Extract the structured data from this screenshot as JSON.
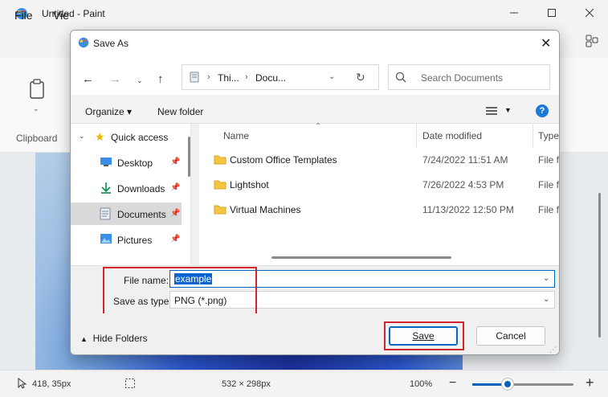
{
  "paint": {
    "title": "Untitled - Paint",
    "menu_file": "File",
    "menu_view": "Vie",
    "clipboard_label": "Clipboard",
    "status": {
      "coords": "418, 35px",
      "size": "532 × 298px",
      "zoom": "100%",
      "zoom_fraction": 0.35
    }
  },
  "dialog": {
    "title": "Save As",
    "address": {
      "seg1": "Thi...",
      "seg2": "Docu..."
    },
    "search_placeholder": "Search Documents",
    "organize_label": "Organize ▾",
    "new_folder_label": "New folder",
    "help_label": "?",
    "nav": {
      "quick_access": "Quick access",
      "items": [
        {
          "label": "Desktop",
          "icon": "desktop-icon"
        },
        {
          "label": "Downloads",
          "icon": "download-icon"
        },
        {
          "label": "Documents",
          "icon": "documents-icon",
          "selected": true
        },
        {
          "label": "Pictures",
          "icon": "pictures-icon"
        }
      ]
    },
    "columns": {
      "name": "Name",
      "date": "Date modified",
      "type": "Type"
    },
    "files": [
      {
        "name": "Custom Office Templates",
        "date": "7/24/2022 11:51 AM",
        "type": "File fo"
      },
      {
        "name": "Lightshot",
        "date": "7/26/2022 4:53 PM",
        "type": "File fo"
      },
      {
        "name": "Virtual Machines",
        "date": "11/13/2022 12:50 PM",
        "type": "File fo"
      }
    ],
    "file_name_label": "File name:",
    "file_name_value": "example",
    "save_type_label": "Save as type:",
    "save_type_value": "PNG (*.png)",
    "hide_folders_label": "Hide Folders",
    "save_label": "Save",
    "cancel_label": "Cancel"
  },
  "colors": {
    "accent": "#0067c0",
    "highlight_box": "#d1242f",
    "folder": "#f5c542"
  }
}
